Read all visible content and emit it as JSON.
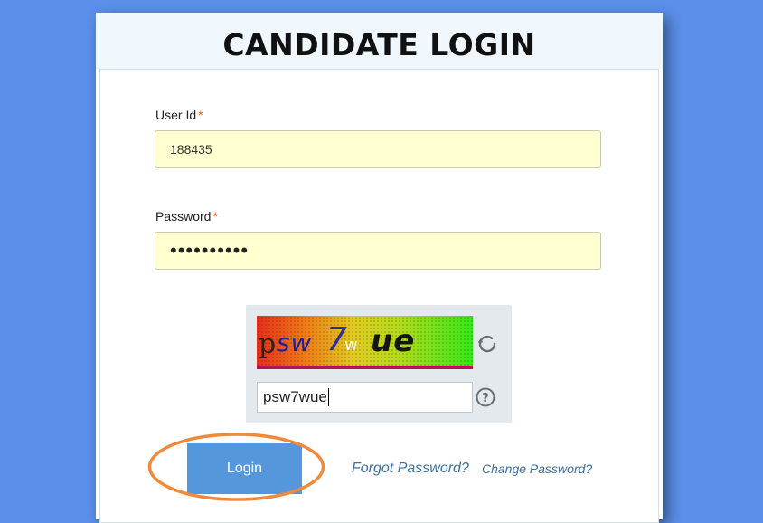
{
  "title": "CANDIDATE LOGIN",
  "user_id": {
    "label": "User Id",
    "required_mark": "*",
    "value": "188435"
  },
  "password": {
    "label": "Password",
    "required_mark": "*",
    "masked_value": "••••••••••"
  },
  "captcha": {
    "image_text": {
      "c1": "p",
      "c2": "sw",
      "c3": "7",
      "c4": "w",
      "c5": "ue"
    },
    "input_value": "psw7wue",
    "refresh_icon": "refresh-icon",
    "help_icon": "help-icon"
  },
  "actions": {
    "login_label": "Login",
    "forgot_password": "Forgot Password?",
    "change_password": "Change Password?"
  },
  "colors": {
    "background": "#5b8fe9",
    "field_fill": "#ffffd0",
    "button": "#5597dd",
    "highlight_ring": "#ee8a3a",
    "link": "#3d6f9c"
  }
}
